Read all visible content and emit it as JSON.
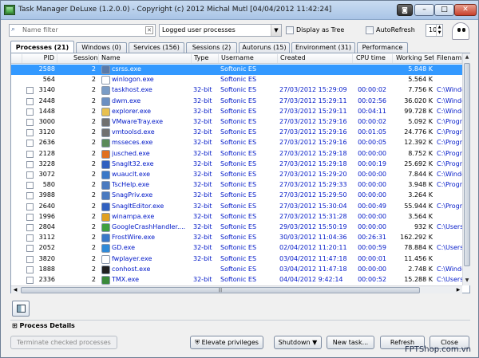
{
  "window": {
    "title": "Task Manager DeLuxe (1.2.0.0) - Copyright (c) 2012 Michal Mutl    [04/04/2012 11:42:24]",
    "camera_label": "◙",
    "minimize_label": "–",
    "maximize_label": "□",
    "close_label": "✕"
  },
  "toolbar": {
    "search_placeholder": "Name filter",
    "search_icon": "⌕",
    "clear_icon": "✕",
    "process_filter": "Logged user processes",
    "dropdown_glyph": "▼",
    "display_tree_label": "Display as Tree",
    "autorefresh_label": "AutoRefresh",
    "refresh_interval": "10",
    "spin_up": "▲",
    "spin_down": "▼"
  },
  "tabs": [
    {
      "label": "Processes (21)"
    },
    {
      "label": "Windows (0)"
    },
    {
      "label": "Services (156)"
    },
    {
      "label": "Sessions (2)"
    },
    {
      "label": "Autoruns (15)"
    },
    {
      "label": "Environment (31)"
    },
    {
      "label": "Performance"
    }
  ],
  "columns": [
    "PID",
    "Session",
    "Name",
    "Type",
    "Username",
    "Created",
    "CPU time",
    "Working Set",
    "Filename"
  ],
  "rows": [
    {
      "pid": "2588",
      "session": "2",
      "name": "csrss.exe",
      "type": "",
      "user": "Softonic ES",
      "created": "",
      "cpu": "",
      "ws": "5.848 K",
      "file": "",
      "icon_color": "#5a7aa8"
    },
    {
      "pid": "564",
      "session": "2",
      "name": "winlogon.exe",
      "type": "",
      "user": "Softonic ES",
      "created": "",
      "cpu": "",
      "ws": "5.564 K",
      "file": "",
      "icon_color": "#ffffff"
    },
    {
      "pid": "3140",
      "session": "2",
      "name": "taskhost.exe",
      "type": "32-bit",
      "user": "Softonic ES",
      "created": "27/03/2012 15:29:09",
      "cpu": "00:00:02",
      "ws": "7.756 K",
      "file": "C:\\Window",
      "icon_color": "#7a9cc6"
    },
    {
      "pid": "2448",
      "session": "2",
      "name": "dwm.exe",
      "type": "32-bit",
      "user": "Softonic ES",
      "created": "27/03/2012 15:29:11",
      "cpu": "00:02:56",
      "ws": "36.020 K",
      "file": "C:\\Window",
      "icon_color": "#6b8fc2"
    },
    {
      "pid": "1448",
      "session": "2",
      "name": "explorer.exe",
      "type": "32-bit",
      "user": "Softonic ES",
      "created": "27/03/2012 15:29:11",
      "cpu": "00:04:11",
      "ws": "99.728 K",
      "file": "C:\\Window",
      "icon_color": "#e8c050"
    },
    {
      "pid": "3000",
      "session": "2",
      "name": "VMwareTray.exe",
      "type": "32-bit",
      "user": "Softonic ES",
      "created": "27/03/2012 15:29:16",
      "cpu": "00:00:02",
      "ws": "5.092 K",
      "file": "C:\\Progran",
      "icon_color": "#707070"
    },
    {
      "pid": "3120",
      "session": "2",
      "name": "vmtoolsd.exe",
      "type": "32-bit",
      "user": "Softonic ES",
      "created": "27/03/2012 15:29:16",
      "cpu": "00:01:05",
      "ws": "24.776 K",
      "file": "C:\\Progran",
      "icon_color": "#707070"
    },
    {
      "pid": "2636",
      "session": "2",
      "name": "msseces.exe",
      "type": "32-bit",
      "user": "Softonic ES",
      "created": "27/03/2012 15:29:16",
      "cpu": "00:00:05",
      "ws": "12.392 K",
      "file": "C:\\Progran",
      "icon_color": "#5a8a5a"
    },
    {
      "pid": "2128",
      "session": "2",
      "name": "jusched.exe",
      "type": "32-bit",
      "user": "Softonic ES",
      "created": "27/03/2012 15:29:18",
      "cpu": "00:00:00",
      "ws": "8.752 K",
      "file": "C:\\Progran",
      "icon_color": "#e07020"
    },
    {
      "pid": "3228",
      "session": "2",
      "name": "SnagIt32.exe",
      "type": "32-bit",
      "user": "Softonic ES",
      "created": "27/03/2012 15:29:18",
      "cpu": "00:00:19",
      "ws": "25.692 K",
      "file": "C:\\Progran",
      "icon_color": "#3060c0"
    },
    {
      "pid": "3072",
      "session": "2",
      "name": "wuauclt.exe",
      "type": "32-bit",
      "user": "Softonic ES",
      "created": "27/03/2012 15:29:20",
      "cpu": "00:00:00",
      "ws": "7.844 K",
      "file": "C:\\Window",
      "icon_color": "#3a78c8"
    },
    {
      "pid": "580",
      "session": "2",
      "name": "TscHelp.exe",
      "type": "32-bit",
      "user": "Softonic ES",
      "created": "27/03/2012 15:29:33",
      "cpu": "00:00:00",
      "ws": "3.948 K",
      "file": "C:\\Progran",
      "icon_color": "#4a7ac0"
    },
    {
      "pid": "3988",
      "session": "2",
      "name": "SnagPriv.exe",
      "type": "32-bit",
      "user": "Softonic ES",
      "created": "27/03/2012 15:29:50",
      "cpu": "00:00:00",
      "ws": "3.264 K",
      "file": "",
      "icon_color": "#4a7ac0"
    },
    {
      "pid": "2640",
      "session": "2",
      "name": "SnagItEditor.exe",
      "type": "32-bit",
      "user": "Softonic ES",
      "created": "27/03/2012 15:30:04",
      "cpu": "00:00:49",
      "ws": "55.944 K",
      "file": "C:\\Progran",
      "icon_color": "#3060c0"
    },
    {
      "pid": "1996",
      "session": "2",
      "name": "winampa.exe",
      "type": "32-bit",
      "user": "Softonic ES",
      "created": "27/03/2012 15:31:28",
      "cpu": "00:00:00",
      "ws": "3.564 K",
      "file": "",
      "icon_color": "#e0a020"
    },
    {
      "pid": "2804",
      "session": "2",
      "name": "GoogleCrashHandler....",
      "type": "32-bit",
      "user": "Softonic ES",
      "created": "29/03/2012 15:50:19",
      "cpu": "00:00:00",
      "ws": "932 K",
      "file": "C:\\Users\\S",
      "icon_color": "#40a040"
    },
    {
      "pid": "3112",
      "session": "2",
      "name": "FrostWire.exe",
      "type": "32-bit",
      "user": "Softonic ES",
      "created": "30/03/2012 11:04:36",
      "cpu": "00:26:31",
      "ws": "162.292 K",
      "file": "",
      "icon_color": "#3a78c8"
    },
    {
      "pid": "2052",
      "session": "2",
      "name": "GD.exe",
      "type": "32-bit",
      "user": "Softonic ES",
      "created": "02/04/2012 11:20:11",
      "cpu": "00:00:59",
      "ws": "78.884 K",
      "file": "C:\\Users\\S",
      "icon_color": "#2f8ad8"
    },
    {
      "pid": "3820",
      "session": "2",
      "name": "fwplayer.exe",
      "type": "32-bit",
      "user": "Softonic ES",
      "created": "03/04/2012 11:47:18",
      "cpu": "00:00:01",
      "ws": "11.456 K",
      "file": "",
      "icon_color": "#ffffff"
    },
    {
      "pid": "1888",
      "session": "2",
      "name": "conhost.exe",
      "type": "",
      "user": "Softonic ES",
      "created": "03/04/2012 11:47:18",
      "cpu": "00:00:00",
      "ws": "2.748 K",
      "file": "C:\\Window",
      "icon_color": "#202020"
    },
    {
      "pid": "2336",
      "session": "2",
      "name": "TMX.exe",
      "type": "32-bit",
      "user": "Softonic ES",
      "created": "04/04/2012 9:42:14",
      "cpu": "00:00:52",
      "ws": "15.288 K",
      "file": "C:\\Users\\S",
      "icon_color": "#3a8a3a"
    }
  ],
  "bottom": {
    "process_details": "Process Details",
    "expand_glyph": "⊞",
    "terminate_label": "Terminate checked processes",
    "elevate_label": "Elevate privileges",
    "shutdown_label": "Shutdown",
    "new_task_label": "New task...",
    "refresh_label": "Refresh",
    "close_label": "Close",
    "dropdown_glyph": "▼"
  },
  "watermark": "FPTShop.com.vn"
}
